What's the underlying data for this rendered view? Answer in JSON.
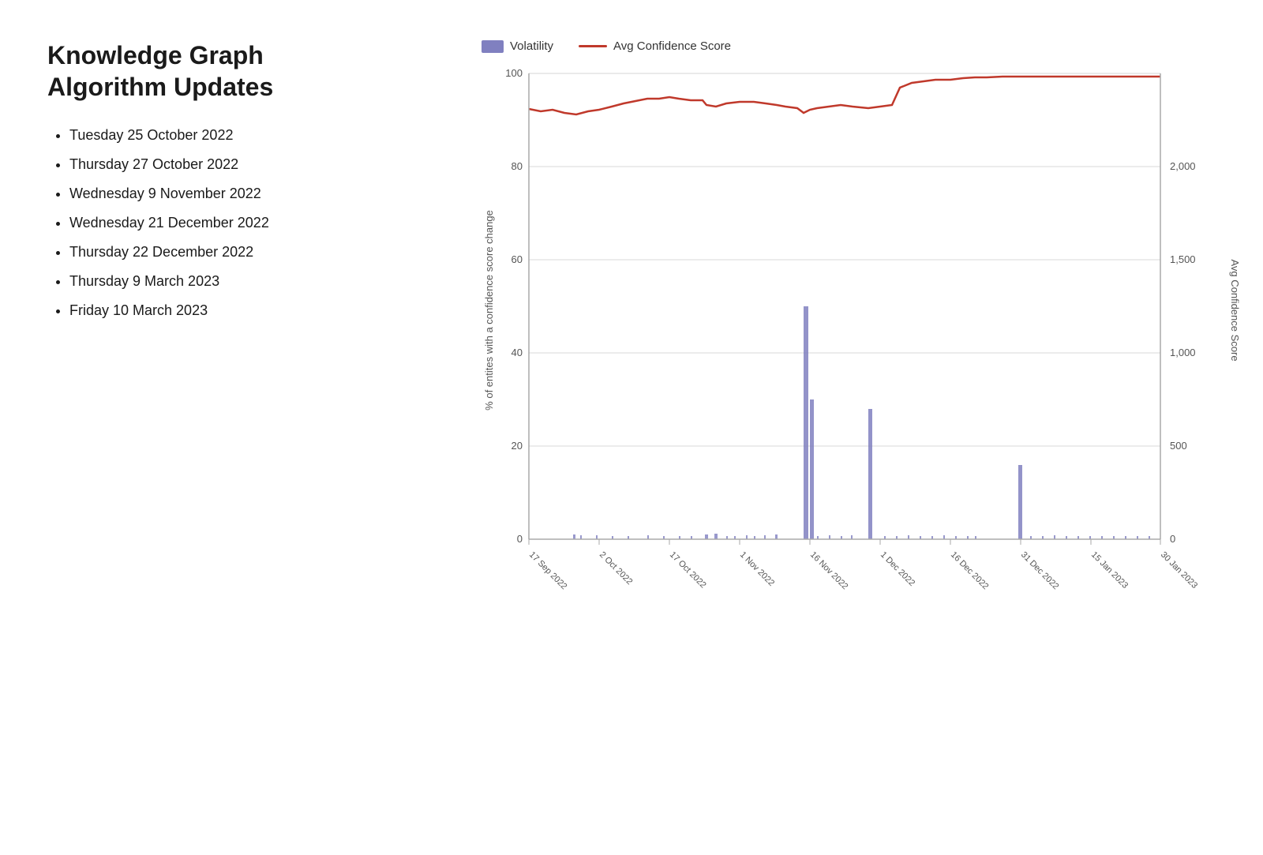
{
  "title": "Knowledge Graph\nAlgorithm Updates",
  "updates": [
    "Tuesday 25 October 2022",
    "Thursday 27 October 2022",
    "Wednesday 9 November 2022",
    "Wednesday 21 December 2022",
    "Thursday 22 December 2022",
    "Thursday 9 March 2023",
    "Friday 10 March 2023"
  ],
  "legend": {
    "volatility_label": "Volatility",
    "confidence_label": "Avg Confidence Score"
  },
  "yaxis_left": {
    "label": "% of entites with a confidence score change",
    "ticks": [
      0,
      20,
      40,
      60,
      80,
      100
    ]
  },
  "yaxis_right": {
    "label": "Avg Confidence Score",
    "ticks": [
      0,
      500,
      1000,
      1500,
      2000
    ]
  },
  "xaxis_ticks": [
    "17 Sep 2022",
    "2 Oct 2022",
    "17 Oct 2022",
    "1 Nov 2022",
    "16 Nov 2022",
    "1 Dec 2022",
    "16 Dec 2022",
    "31 Dec 2022",
    "15 Jan 2023",
    "30 Jan 2023"
  ]
}
